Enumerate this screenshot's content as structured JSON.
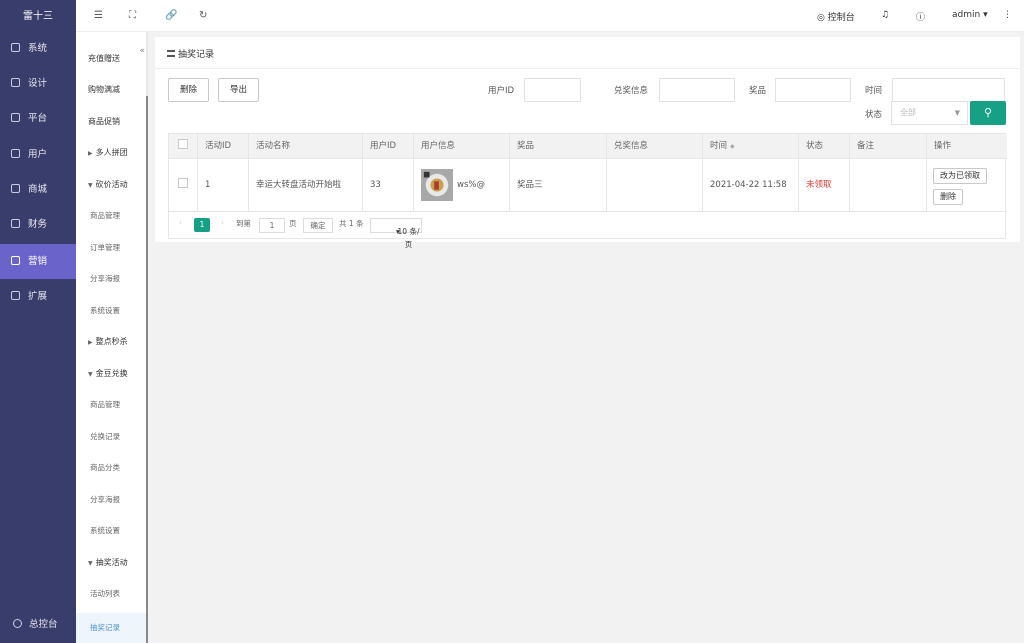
{
  "sidebar": {
    "logo": "雷十三",
    "items": [
      {
        "label": "系统",
        "icon": "gear-icon"
      },
      {
        "label": "设计",
        "icon": "design-icon"
      },
      {
        "label": "平台",
        "icon": "platform-icon"
      },
      {
        "label": "用户",
        "icon": "user-icon"
      },
      {
        "label": "商城",
        "icon": "shop-icon"
      },
      {
        "label": "财务",
        "icon": "finance-icon"
      },
      {
        "label": "营销",
        "icon": "gift-icon"
      },
      {
        "label": "扩展",
        "icon": "grid-icon"
      }
    ],
    "bottom": "总控台",
    "active_color": "#6a63c9"
  },
  "submenu": {
    "items": [
      {
        "label": "充值赠送",
        "kind": "item"
      },
      {
        "label": "购物满减",
        "kind": "item"
      },
      {
        "label": "商品促销",
        "kind": "item"
      },
      {
        "label": "多人拼团",
        "kind": "group",
        "open": false
      },
      {
        "label": "砍价活动",
        "kind": "group",
        "open": true
      },
      {
        "label": "商品管理",
        "kind": "leaf"
      },
      {
        "label": "订单管理",
        "kind": "leaf"
      },
      {
        "label": "分享海报",
        "kind": "leaf"
      },
      {
        "label": "系统设置",
        "kind": "leaf"
      },
      {
        "label": "整点秒杀",
        "kind": "group",
        "open": false
      },
      {
        "label": "金豆兑换",
        "kind": "group",
        "open": true
      },
      {
        "label": "商品管理",
        "kind": "leaf"
      },
      {
        "label": "兑换记录",
        "kind": "leaf"
      },
      {
        "label": "商品分类",
        "kind": "leaf"
      },
      {
        "label": "分享海报",
        "kind": "leaf"
      },
      {
        "label": "系统设置",
        "kind": "leaf"
      },
      {
        "label": "抽奖活动",
        "kind": "group",
        "open": true
      },
      {
        "label": "活动列表",
        "kind": "leaf"
      },
      {
        "label": "抽奖记录",
        "kind": "leaf",
        "active": true
      }
    ]
  },
  "topbar": {
    "console": "控制台",
    "user": "admin"
  },
  "page": {
    "title": "抽奖记录",
    "buttons": {
      "delete": "删除",
      "export": "导出"
    },
    "filters": {
      "user_id": "用户ID",
      "redeem_info": "兑奖信息",
      "prize": "奖品",
      "time": "时间",
      "status": "状态",
      "status_placeholder": "全部"
    }
  },
  "table": {
    "columns": [
      "活动ID",
      "活动名称",
      "用户ID",
      "用户信息",
      "奖品",
      "兑奖信息",
      "时间",
      "状态",
      "备注",
      "操作"
    ],
    "rows": [
      {
        "activity_id": "1",
        "activity_name": "幸运大转盘活动开始啦",
        "user_id": "33",
        "user_info": "ws%@",
        "prize": "奖品三",
        "redeem_info": "",
        "time": "2021-04-22 11:58",
        "status": "未领取",
        "remark": "",
        "actions": [
          "改为已领取",
          "删除"
        ]
      }
    ],
    "status_color": "#e53935"
  },
  "pager": {
    "current": "1",
    "goto": "到第",
    "goto_value": "1",
    "page_unit": "页",
    "confirm": "确定",
    "total": "共 1 条",
    "per_page": "10 条/页"
  }
}
